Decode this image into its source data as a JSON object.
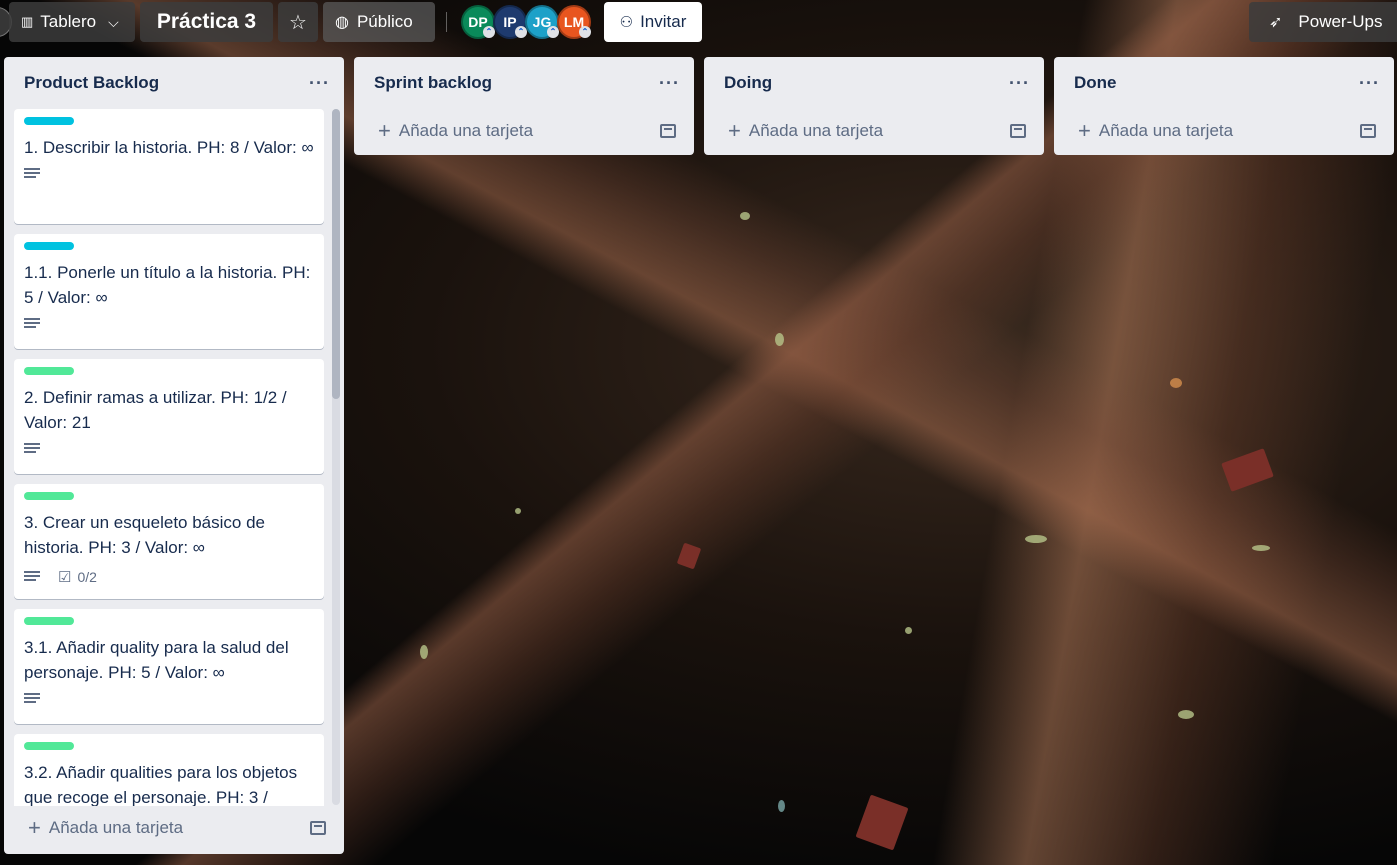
{
  "header": {
    "board_view_label": "Tablero",
    "board_title": "Práctica 3",
    "visibility_label": "Público",
    "invite_label": "Invitar",
    "powerups_label": "Power-Ups",
    "members": [
      {
        "initials": "DP",
        "color": "#0a8a5a"
      },
      {
        "initials": "IP",
        "color": "#1e3a6e"
      },
      {
        "initials": "JG",
        "color": "#1da1c8"
      },
      {
        "initials": "LM",
        "color": "#e8551f"
      }
    ]
  },
  "lists": [
    {
      "title": "Product Backlog",
      "menu": "···",
      "add_label": "Añada una tarjeta",
      "cards": [
        {
          "label_color": "#00c2e0",
          "title": "1. Describir la historia. PH: 8 / Valor: ∞"
        },
        {
          "label_color": "#00c2e0",
          "title": "1.1. Ponerle un título a la historia. PH: 5 / Valor: ∞"
        },
        {
          "label_color": "#51e898",
          "title": "2. Definir ramas a utilizar. PH: 1/2 / Valor: 21"
        },
        {
          "label_color": "#51e898",
          "title": "3. Crear un esqueleto básico de historia. PH: 3 / Valor: ∞",
          "checklist": "0/2"
        },
        {
          "label_color": "#51e898",
          "title": "3.1. Añadir quality para la salud del personaje. PH: 5 / Valor: ∞"
        },
        {
          "label_color": "#51e898",
          "title": "3.2. Añadir qualities para los objetos que recoge el personaje. PH: 3 /"
        }
      ]
    },
    {
      "title": "Sprint backlog",
      "menu": "···",
      "add_label": "Añada una tarjeta"
    },
    {
      "title": "Doing",
      "menu": "···",
      "add_label": "Añada una tarjeta"
    },
    {
      "title": "Done",
      "menu": "···",
      "add_label": "Añada una tarjeta"
    }
  ]
}
